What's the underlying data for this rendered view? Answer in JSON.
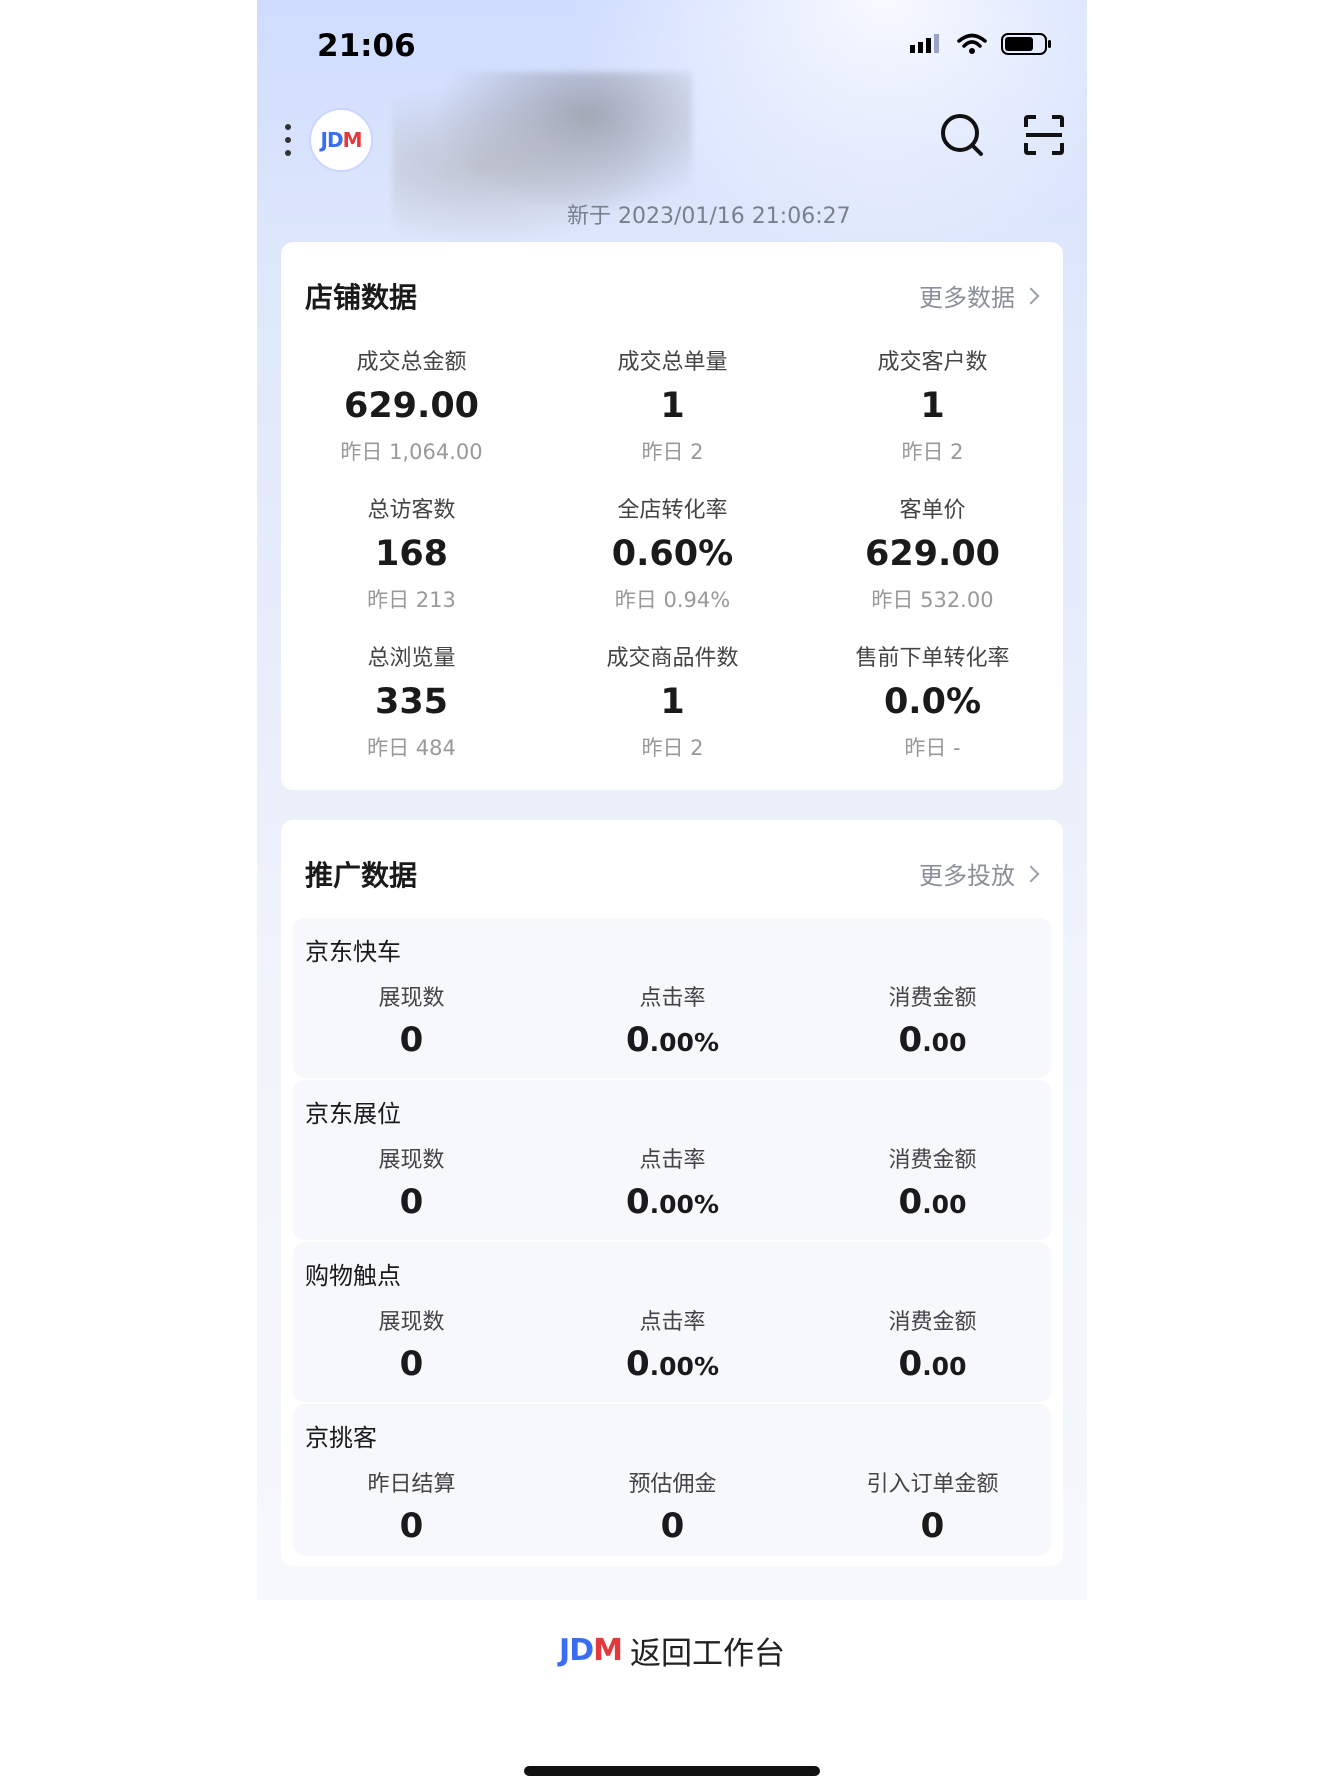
{
  "status_bar": {
    "time": "21:06"
  },
  "header": {
    "logo_text_jd": "JD",
    "logo_text_m": "M",
    "update_text": "新于 2023/01/16 21:06:27"
  },
  "shop": {
    "title": "店铺数据",
    "more_label": "更多数据",
    "metrics": [
      {
        "label": "成交总金额",
        "value": "629.00",
        "prev": "昨日 1,064.00"
      },
      {
        "label": "成交总单量",
        "value": "1",
        "prev": "昨日 2"
      },
      {
        "label": "成交客户数",
        "value": "1",
        "prev": "昨日 2"
      },
      {
        "label": "总访客数",
        "value": "168",
        "prev": "昨日 213"
      },
      {
        "label": "全店转化率",
        "value": "0.60%",
        "prev": "昨日 0.94%"
      },
      {
        "label": "客单价",
        "value": "629.00",
        "prev": "昨日 532.00"
      },
      {
        "label": "总浏览量",
        "value": "335",
        "prev": "昨日 484"
      },
      {
        "label": "成交商品件数",
        "value": "1",
        "prev": "昨日 2"
      },
      {
        "label": "售前下单转化率",
        "value": "0.0%",
        "prev": "昨日 -"
      }
    ]
  },
  "promo": {
    "title": "推广数据",
    "more_label": "更多投放",
    "sections": [
      {
        "name": "京东快车",
        "metrics": [
          {
            "label": "展现数",
            "value": "0",
            "suffix": ""
          },
          {
            "label": "点击率",
            "value": "0",
            "suffix": ".00%"
          },
          {
            "label": "消费金额",
            "value": "0",
            "suffix": ".00"
          }
        ]
      },
      {
        "name": "京东展位",
        "metrics": [
          {
            "label": "展现数",
            "value": "0",
            "suffix": ""
          },
          {
            "label": "点击率",
            "value": "0",
            "suffix": ".00%"
          },
          {
            "label": "消费金额",
            "value": "0",
            "suffix": ".00"
          }
        ]
      },
      {
        "name": "购物触点",
        "metrics": [
          {
            "label": "展现数",
            "value": "0",
            "suffix": ""
          },
          {
            "label": "点击率",
            "value": "0",
            "suffix": ".00%"
          },
          {
            "label": "消费金额",
            "value": "0",
            "suffix": ".00"
          }
        ]
      },
      {
        "name": "京挑客",
        "metrics": [
          {
            "label": "昨日结算",
            "value": "0",
            "suffix": ""
          },
          {
            "label": "预估佣金",
            "value": "0",
            "suffix": ""
          },
          {
            "label": "引入订单金额",
            "value": "0",
            "suffix": ""
          }
        ]
      }
    ]
  },
  "footer": {
    "brand_jd": "JD",
    "brand_m": "M",
    "label": "返回工作台"
  },
  "colors": {
    "jd_blue": "#3a6df0",
    "jd_red": "#e4393c"
  }
}
